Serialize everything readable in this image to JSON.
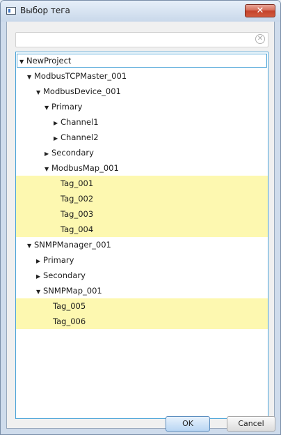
{
  "window": {
    "title": "Выбор тега",
    "close_label": "✕"
  },
  "search": {
    "value": "",
    "placeholder": "",
    "clear_glyph": "✕"
  },
  "tree": {
    "nodes": [
      {
        "label": "NewProject",
        "arrow": "▼"
      },
      {
        "label": "ModbusTCPMaster_001",
        "arrow": "▼"
      },
      {
        "label": "ModbusDevice_001",
        "arrow": "▼"
      },
      {
        "label": "Primary",
        "arrow": "▼"
      },
      {
        "label": "Channel1",
        "arrow": "▶"
      },
      {
        "label": "Channel2",
        "arrow": "▶"
      },
      {
        "label": "Secondary",
        "arrow": "▶"
      },
      {
        "label": "ModbusMap_001",
        "arrow": "▼"
      },
      {
        "label": "Tag_001",
        "arrow": ""
      },
      {
        "label": "Tag_002",
        "arrow": ""
      },
      {
        "label": "Tag_003",
        "arrow": ""
      },
      {
        "label": "Tag_004",
        "arrow": ""
      },
      {
        "label": "SNMPManager_001",
        "arrow": "▼"
      },
      {
        "label": "Primary",
        "arrow": "▶"
      },
      {
        "label": "Secondary",
        "arrow": "▶"
      },
      {
        "label": "SNMPMap_001",
        "arrow": "▼"
      },
      {
        "label": "Tag_005",
        "arrow": ""
      },
      {
        "label": "Tag_006",
        "arrow": ""
      }
    ],
    "highlight_color": "#fdf8b0"
  },
  "buttons": {
    "ok_label": "OK",
    "cancel_label": "Cancel"
  }
}
